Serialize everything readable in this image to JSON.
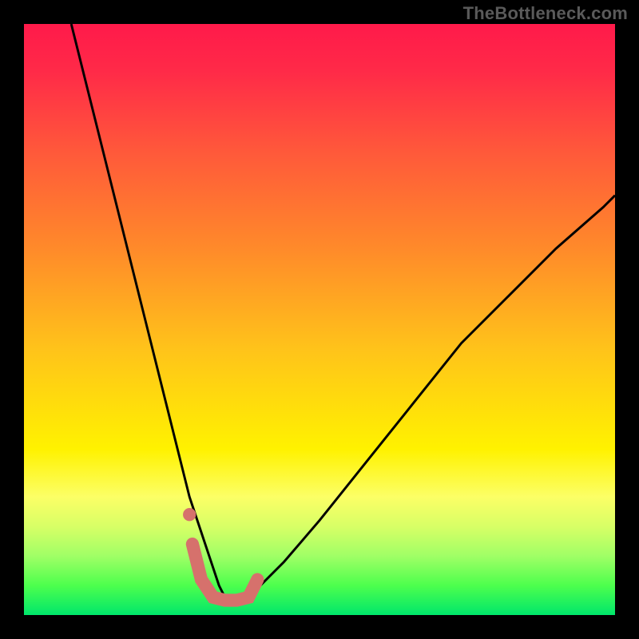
{
  "watermark": "TheBottleneck.com",
  "chart_data": {
    "type": "line",
    "title": "",
    "xlabel": "",
    "ylabel": "",
    "xlim": [
      0,
      100
    ],
    "ylim": [
      0,
      100
    ],
    "grid": false,
    "legend": false,
    "series": [
      {
        "name": "bottleneck-curve",
        "x": [
          8,
          12,
          16,
          20,
          24,
          26,
          28,
          30,
          32,
          33,
          34,
          36,
          38,
          40,
          44,
          50,
          58,
          66,
          74,
          82,
          90,
          98,
          100
        ],
        "y": [
          100,
          84,
          68,
          52,
          36,
          28,
          20,
          14,
          8,
          5,
          3,
          3,
          3,
          5,
          9,
          16,
          26,
          36,
          46,
          54,
          62,
          69,
          71
        ],
        "color": "#000000",
        "stroke_width": 3
      },
      {
        "name": "highlight-segment",
        "x": [
          28.5,
          30,
          32,
          34,
          36,
          38,
          39.5
        ],
        "y": [
          12,
          6,
          3,
          2.5,
          2.5,
          3,
          6
        ],
        "color": "#d6716c",
        "stroke_width": 16,
        "linecap": "round"
      }
    ],
    "points": [
      {
        "name": "highlight-dot",
        "x": 28,
        "y": 17,
        "r": 8,
        "color": "#d6716c"
      }
    ],
    "background_gradient": {
      "top": "#ff1a4a",
      "mid": "#fff200",
      "bottom": "#00e66b"
    }
  }
}
